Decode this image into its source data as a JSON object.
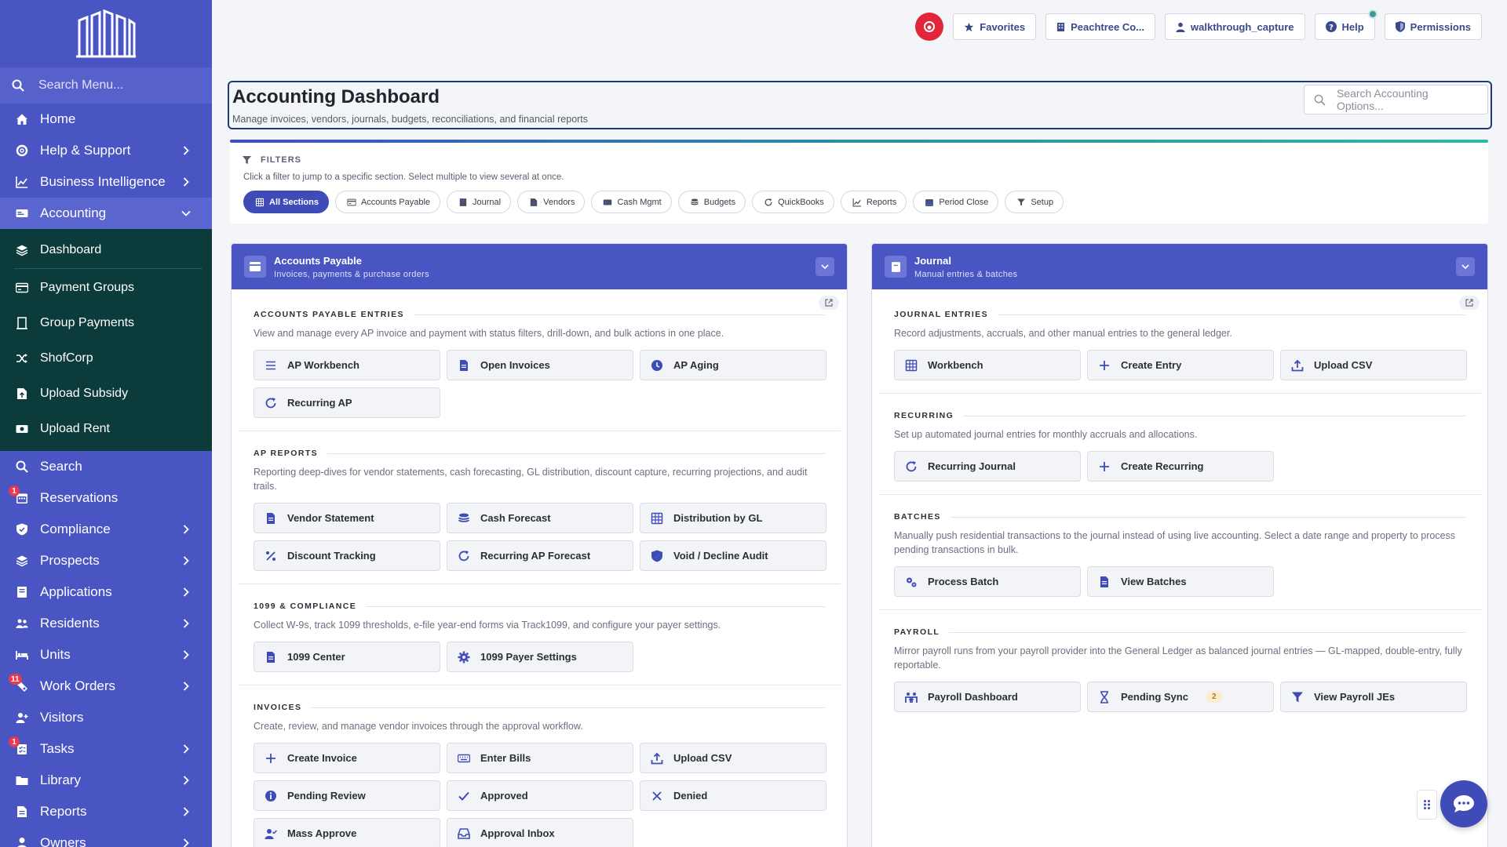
{
  "colors": {
    "sidebar": "#4a55c4",
    "sidebar_accent": "#0c3b3c",
    "card_header": "#4a55c4",
    "record": "#e3263b",
    "chip_active": "#3f4cb8"
  },
  "sidebar": {
    "search_placeholder": "Search Menu...",
    "items_top": [
      {
        "label": "Home",
        "icon": "home-icon"
      },
      {
        "label": "Help & Support",
        "icon": "life-ring-icon",
        "chevron": true
      },
      {
        "label": "Business Intelligence",
        "icon": "chart-line-icon",
        "chevron": true
      },
      {
        "label": "Accounting",
        "icon": "money-icon",
        "expanded": true
      }
    ],
    "accounting_sub": [
      {
        "label": "Dashboard",
        "icon": "dashboard-icon"
      },
      {
        "label": "Payment Groups",
        "icon": "card-icon"
      },
      {
        "label": "Group Payments",
        "icon": "receipt-icon"
      },
      {
        "label": "ShofCorp",
        "icon": "shuffle-icon"
      },
      {
        "label": "Upload Subsidy",
        "icon": "file-upload-icon"
      },
      {
        "label": "Upload Rent",
        "icon": "cash-icon"
      }
    ],
    "items_bottom": [
      {
        "label": "Search",
        "icon": "search-icon"
      },
      {
        "label": "Reservations",
        "icon": "calendar-icon",
        "badge": "1"
      },
      {
        "label": "Compliance",
        "icon": "shield-icon",
        "chevron": true
      },
      {
        "label": "Prospects",
        "icon": "layers-icon",
        "chevron": true
      },
      {
        "label": "Applications",
        "icon": "book-icon",
        "chevron": true
      },
      {
        "label": "Residents",
        "icon": "users-icon",
        "chevron": true
      },
      {
        "label": "Units",
        "icon": "bed-icon",
        "chevron": true
      },
      {
        "label": "Work Orders",
        "icon": "wrench-icon",
        "chevron": true,
        "badge": "11"
      },
      {
        "label": "Visitors",
        "icon": "user-plus-icon"
      },
      {
        "label": "Tasks",
        "icon": "tasks-icon",
        "chevron": true,
        "badge": "1"
      },
      {
        "label": "Library",
        "icon": "folder-icon",
        "chevron": true
      },
      {
        "label": "Reports",
        "icon": "report-icon",
        "chevron": true
      },
      {
        "label": "Owners",
        "icon": "owner-icon",
        "chevron": true
      }
    ]
  },
  "topbar": {
    "favorites": "Favorites",
    "company": "Peachtree Co...",
    "user": "walkthrough_capture",
    "help": "Help",
    "permissions": "Permissions"
  },
  "header": {
    "title": "Accounting Dashboard",
    "subtitle": "Manage invoices, vendors, journals, budgets, reconciliations, and financial reports",
    "search_placeholder": "Search Accounting Options..."
  },
  "filters": {
    "title": "FILTERS",
    "hint": "Click a filter to jump to a specific section. Select multiple to view several at once.",
    "chips": [
      "All Sections",
      "Accounts Payable",
      "Journal",
      "Vendors",
      "Cash Mgmt",
      "Budgets",
      "QuickBooks",
      "Reports",
      "Period Close",
      "Setup"
    ]
  },
  "ap_card": {
    "title": "Accounts Payable",
    "subtitle": "Invoices, payments & purchase orders",
    "sections": [
      {
        "title": "ACCOUNTS PAYABLE ENTRIES",
        "desc": "View and manage every AP invoice and payment with status filters, drill-down, and bulk actions in one place.",
        "tiles": [
          {
            "label": "AP Workbench",
            "icon": "list-icon"
          },
          {
            "label": "Open Invoices",
            "icon": "file-icon"
          },
          {
            "label": "AP Aging",
            "icon": "clock-icon"
          },
          {
            "label": "Recurring AP",
            "icon": "refresh-icon"
          }
        ]
      },
      {
        "title": "AP REPORTS",
        "desc": "Reporting deep-dives for vendor statements, cash forecasting, GL distribution, discount capture, recurring projections, and audit trails.",
        "tiles": [
          {
            "label": "Vendor Statement",
            "icon": "file-icon"
          },
          {
            "label": "Cash Forecast",
            "icon": "coins-icon"
          },
          {
            "label": "Distribution by GL",
            "icon": "grid-icon"
          },
          {
            "label": "Discount Tracking",
            "icon": "percent-icon"
          },
          {
            "label": "Recurring AP Forecast",
            "icon": "refresh-icon"
          },
          {
            "label": "Void / Decline Audit",
            "icon": "shield-icon"
          }
        ]
      },
      {
        "title": "1099 & COMPLIANCE",
        "desc": "Collect W-9s, track 1099 thresholds, e-file year-end forms via Track1099, and configure your payer settings.",
        "tiles": [
          {
            "label": "1099 Center",
            "icon": "file-icon"
          },
          {
            "label": "1099 Payer Settings",
            "icon": "gear-icon"
          }
        ]
      },
      {
        "title": "INVOICES",
        "desc": "Create, review, and manage vendor invoices through the approval workflow.",
        "tiles": [
          {
            "label": "Create Invoice",
            "icon": "plus-icon"
          },
          {
            "label": "Enter Bills",
            "icon": "keyboard-icon"
          },
          {
            "label": "Upload CSV",
            "icon": "upload-icon"
          },
          {
            "label": "Pending Review",
            "icon": "info-icon"
          },
          {
            "label": "Approved",
            "icon": "check-icon"
          },
          {
            "label": "Denied",
            "icon": "x-icon"
          },
          {
            "label": "Mass Approve",
            "icon": "user-check-icon"
          },
          {
            "label": "Approval Inbox",
            "icon": "inbox-icon"
          }
        ]
      }
    ]
  },
  "journal_card": {
    "title": "Journal",
    "subtitle": "Manual entries & batches",
    "sections": [
      {
        "title": "JOURNAL ENTRIES",
        "desc": "Record adjustments, accruals, and other manual entries to the general ledger.",
        "tiles": [
          {
            "label": "Workbench",
            "icon": "grid-icon"
          },
          {
            "label": "Create Entry",
            "icon": "plus-icon"
          },
          {
            "label": "Upload CSV",
            "icon": "upload-icon"
          }
        ]
      },
      {
        "title": "RECURRING",
        "desc": "Set up automated journal entries for monthly accruals and allocations.",
        "tiles": [
          {
            "label": "Recurring Journal",
            "icon": "refresh-icon"
          },
          {
            "label": "Create Recurring",
            "icon": "plus-icon"
          }
        ]
      },
      {
        "title": "BATCHES",
        "desc": "Manually push residential transactions to the journal instead of using live accounting. Select a date range and property to process pending transactions in bulk.",
        "tiles": [
          {
            "label": "Process Batch",
            "icon": "gears-icon"
          },
          {
            "label": "View Batches",
            "icon": "file-icon"
          }
        ]
      },
      {
        "title": "PAYROLL",
        "desc": "Mirror payroll runs from your payroll provider into the General Ledger as balanced journal entries — GL-mapped, double-entry, fully reportable.",
        "tiles": [
          {
            "label": "Payroll Dashboard",
            "icon": "people-icon"
          },
          {
            "label": "Pending Sync",
            "icon": "hourglass-icon",
            "count": "2"
          },
          {
            "label": "View Payroll JEs",
            "icon": "filter-icon"
          }
        ]
      }
    ]
  }
}
